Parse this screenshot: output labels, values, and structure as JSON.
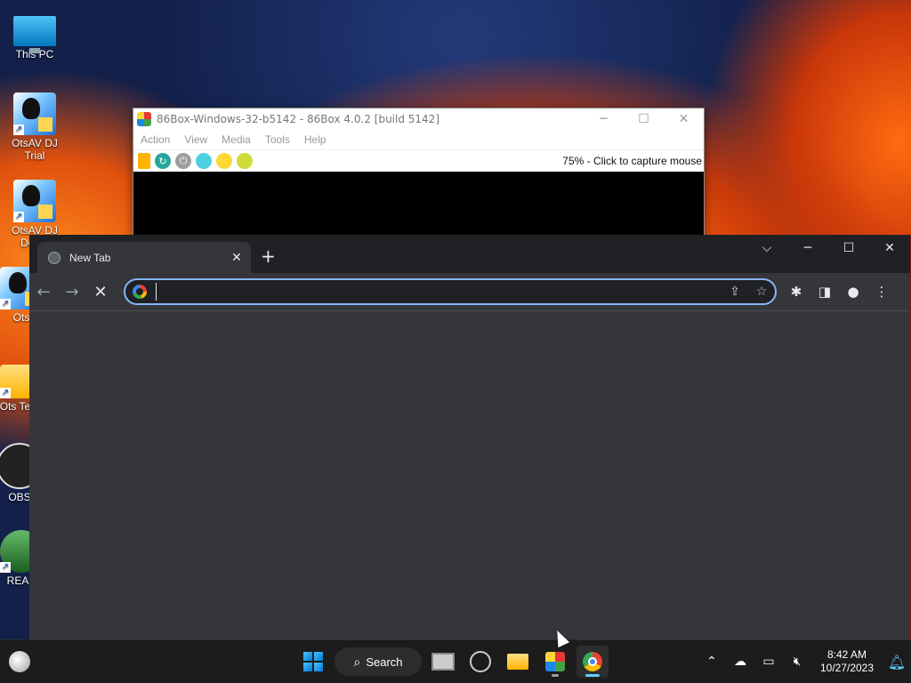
{
  "desktop": {
    "icons": [
      {
        "label": "This PC"
      },
      {
        "label": "OtsAV DJ Trial"
      },
      {
        "label": "OtsAV DJ Demo"
      },
      {
        "label": "Ots"
      },
      {
        "label": "Ots Term"
      },
      {
        "label": "OBS"
      },
      {
        "label": "REAP"
      }
    ]
  },
  "box86": {
    "title": "86Box-Windows-32-b5142 - 86Box 4.0.2 [build 5142]",
    "menus": [
      "Action",
      "View",
      "Media",
      "Tools",
      "Help"
    ],
    "status": "75% - Click to capture mouse"
  },
  "chrome": {
    "tab_title": "New Tab",
    "new_tab_symbol": "+",
    "address_value": "",
    "address_placeholder": ""
  },
  "taskbar": {
    "search_label": "Search",
    "time": "8:42 AM",
    "date": "10/27/2023"
  },
  "colors": {
    "chrome_bg": "#202124",
    "chrome_toolbar": "#35363a",
    "focus_ring": "#8ab4f8",
    "taskbar_bg": "#1c1c1c",
    "accent": "#60cdff"
  }
}
